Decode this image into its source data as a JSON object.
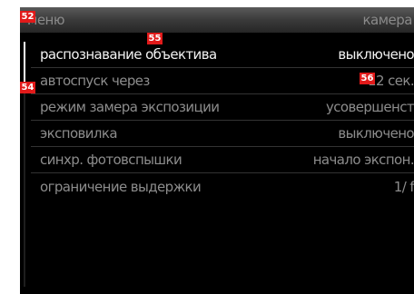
{
  "header": {
    "title": "меню",
    "tab": "камера"
  },
  "menu_items": [
    {
      "label": "распознавание объектива",
      "value": "выключено"
    },
    {
      "label": "автоспуск через",
      "value": "12 сек."
    },
    {
      "label": "режим замера экспозиции",
      "value": "усовершенст"
    },
    {
      "label": "эксповилка",
      "value": "выключено"
    },
    {
      "label": "синхр. фотовспышки",
      "value": "начало экспон."
    },
    {
      "label": "ограничение выдержки",
      "value": "1/ f"
    }
  ],
  "markers": {
    "m52": "52",
    "m54": "54",
    "m55": "55",
    "m56": "56"
  },
  "colors": {
    "marker_bg": "#e11a1a",
    "screen_bg": "#000000",
    "text_dim": "#8c8c8c",
    "text_selected": "#f2f2f2"
  },
  "selected_index": 0
}
